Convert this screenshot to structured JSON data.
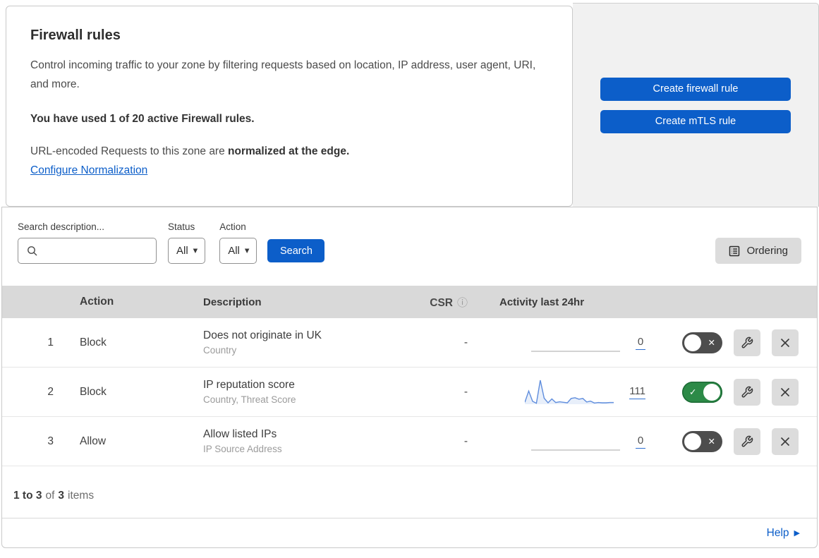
{
  "header": {
    "title": "Firewall rules",
    "description": "Control incoming traffic to your zone by filtering requests based on location, IP address, user agent, URI, and more.",
    "usage": "You have used 1 of 20 active Firewall rules.",
    "normalization_prefix": "URL-encoded Requests to this zone are ",
    "normalization_bold": "normalized at the edge.",
    "normalization_link": "Configure Normalization",
    "buttons": [
      {
        "label": "Create firewall rule"
      },
      {
        "label": "Create mTLS rule"
      }
    ]
  },
  "filters": {
    "search_label": "Search description...",
    "search_value": "",
    "status_label": "Status",
    "status_value": "All",
    "action_label": "Action",
    "action_value": "All",
    "search_button": "Search",
    "ordering_button": "Ordering"
  },
  "table": {
    "columns": [
      "Action",
      "Description",
      "CSR",
      "Activity last 24hr"
    ],
    "rows": [
      {
        "priority": "1",
        "action": "Block",
        "description": "Does not originate in UK",
        "expression": "Country",
        "csr": "-",
        "activity_count": "0",
        "enabled": false,
        "activity_values": []
      },
      {
        "priority": "2",
        "action": "Block",
        "description": "IP reputation score",
        "expression": "Country, Threat Score",
        "csr": "-",
        "activity_count": "111",
        "enabled": true,
        "activity_values": [
          8,
          55,
          12,
          4,
          100,
          25,
          6,
          22,
          7,
          10,
          8,
          6,
          24,
          27,
          21,
          24,
          9,
          13,
          5,
          7,
          6,
          6,
          7,
          7
        ]
      },
      {
        "priority": "3",
        "action": "Allow",
        "description": "Allow listed IPs",
        "expression": "IP Source Address",
        "csr": "-",
        "activity_count": "0",
        "enabled": false,
        "activity_values": []
      }
    ]
  },
  "footer": {
    "range_bold": "1 to 3",
    "of_text": "of",
    "total_bold": "3",
    "items_text": "items",
    "help_label": "Help"
  },
  "icons": {
    "caret_down": "▼",
    "caret_right": "▶",
    "check": "✓",
    "cross": "✕",
    "info": "ⓘ"
  },
  "colors": {
    "primary_blue": "#0c5ec9",
    "toggle_green": "#2c8a47",
    "toggle_off_gray": "#4d4d4d",
    "sparkline_blue": "#5f8ddd",
    "sparkline_fill": "rgba(95,141,221,0.14)",
    "sparkline_empty": "#b9b9b9"
  }
}
